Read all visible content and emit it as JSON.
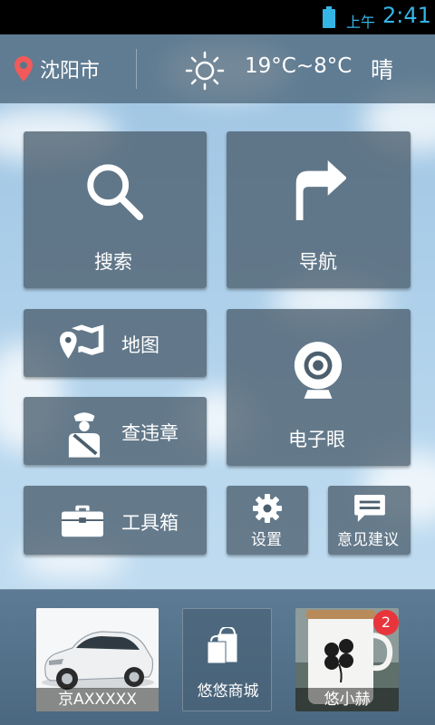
{
  "status_bar": {
    "ampm": "上午",
    "time": "2:41"
  },
  "header": {
    "city": "沈阳市",
    "temperature": "19°C~8°C",
    "weather": "晴"
  },
  "tiles": {
    "search": "搜索",
    "navigation": "导航",
    "map": "地图",
    "violation": "查违章",
    "e_eye": "电子眼",
    "toolbox": "工具箱",
    "settings": "设置",
    "feedback": "意见建议"
  },
  "bottom": {
    "car": {
      "label": "京AXXXXX"
    },
    "mall": {
      "label": "悠悠商城"
    },
    "profile": {
      "label": "悠小赫",
      "badge": "2"
    }
  },
  "colors": {
    "status_accent": "#33b5e5",
    "badge": "#e8353c",
    "tile_bg": "#4b5f6e"
  }
}
